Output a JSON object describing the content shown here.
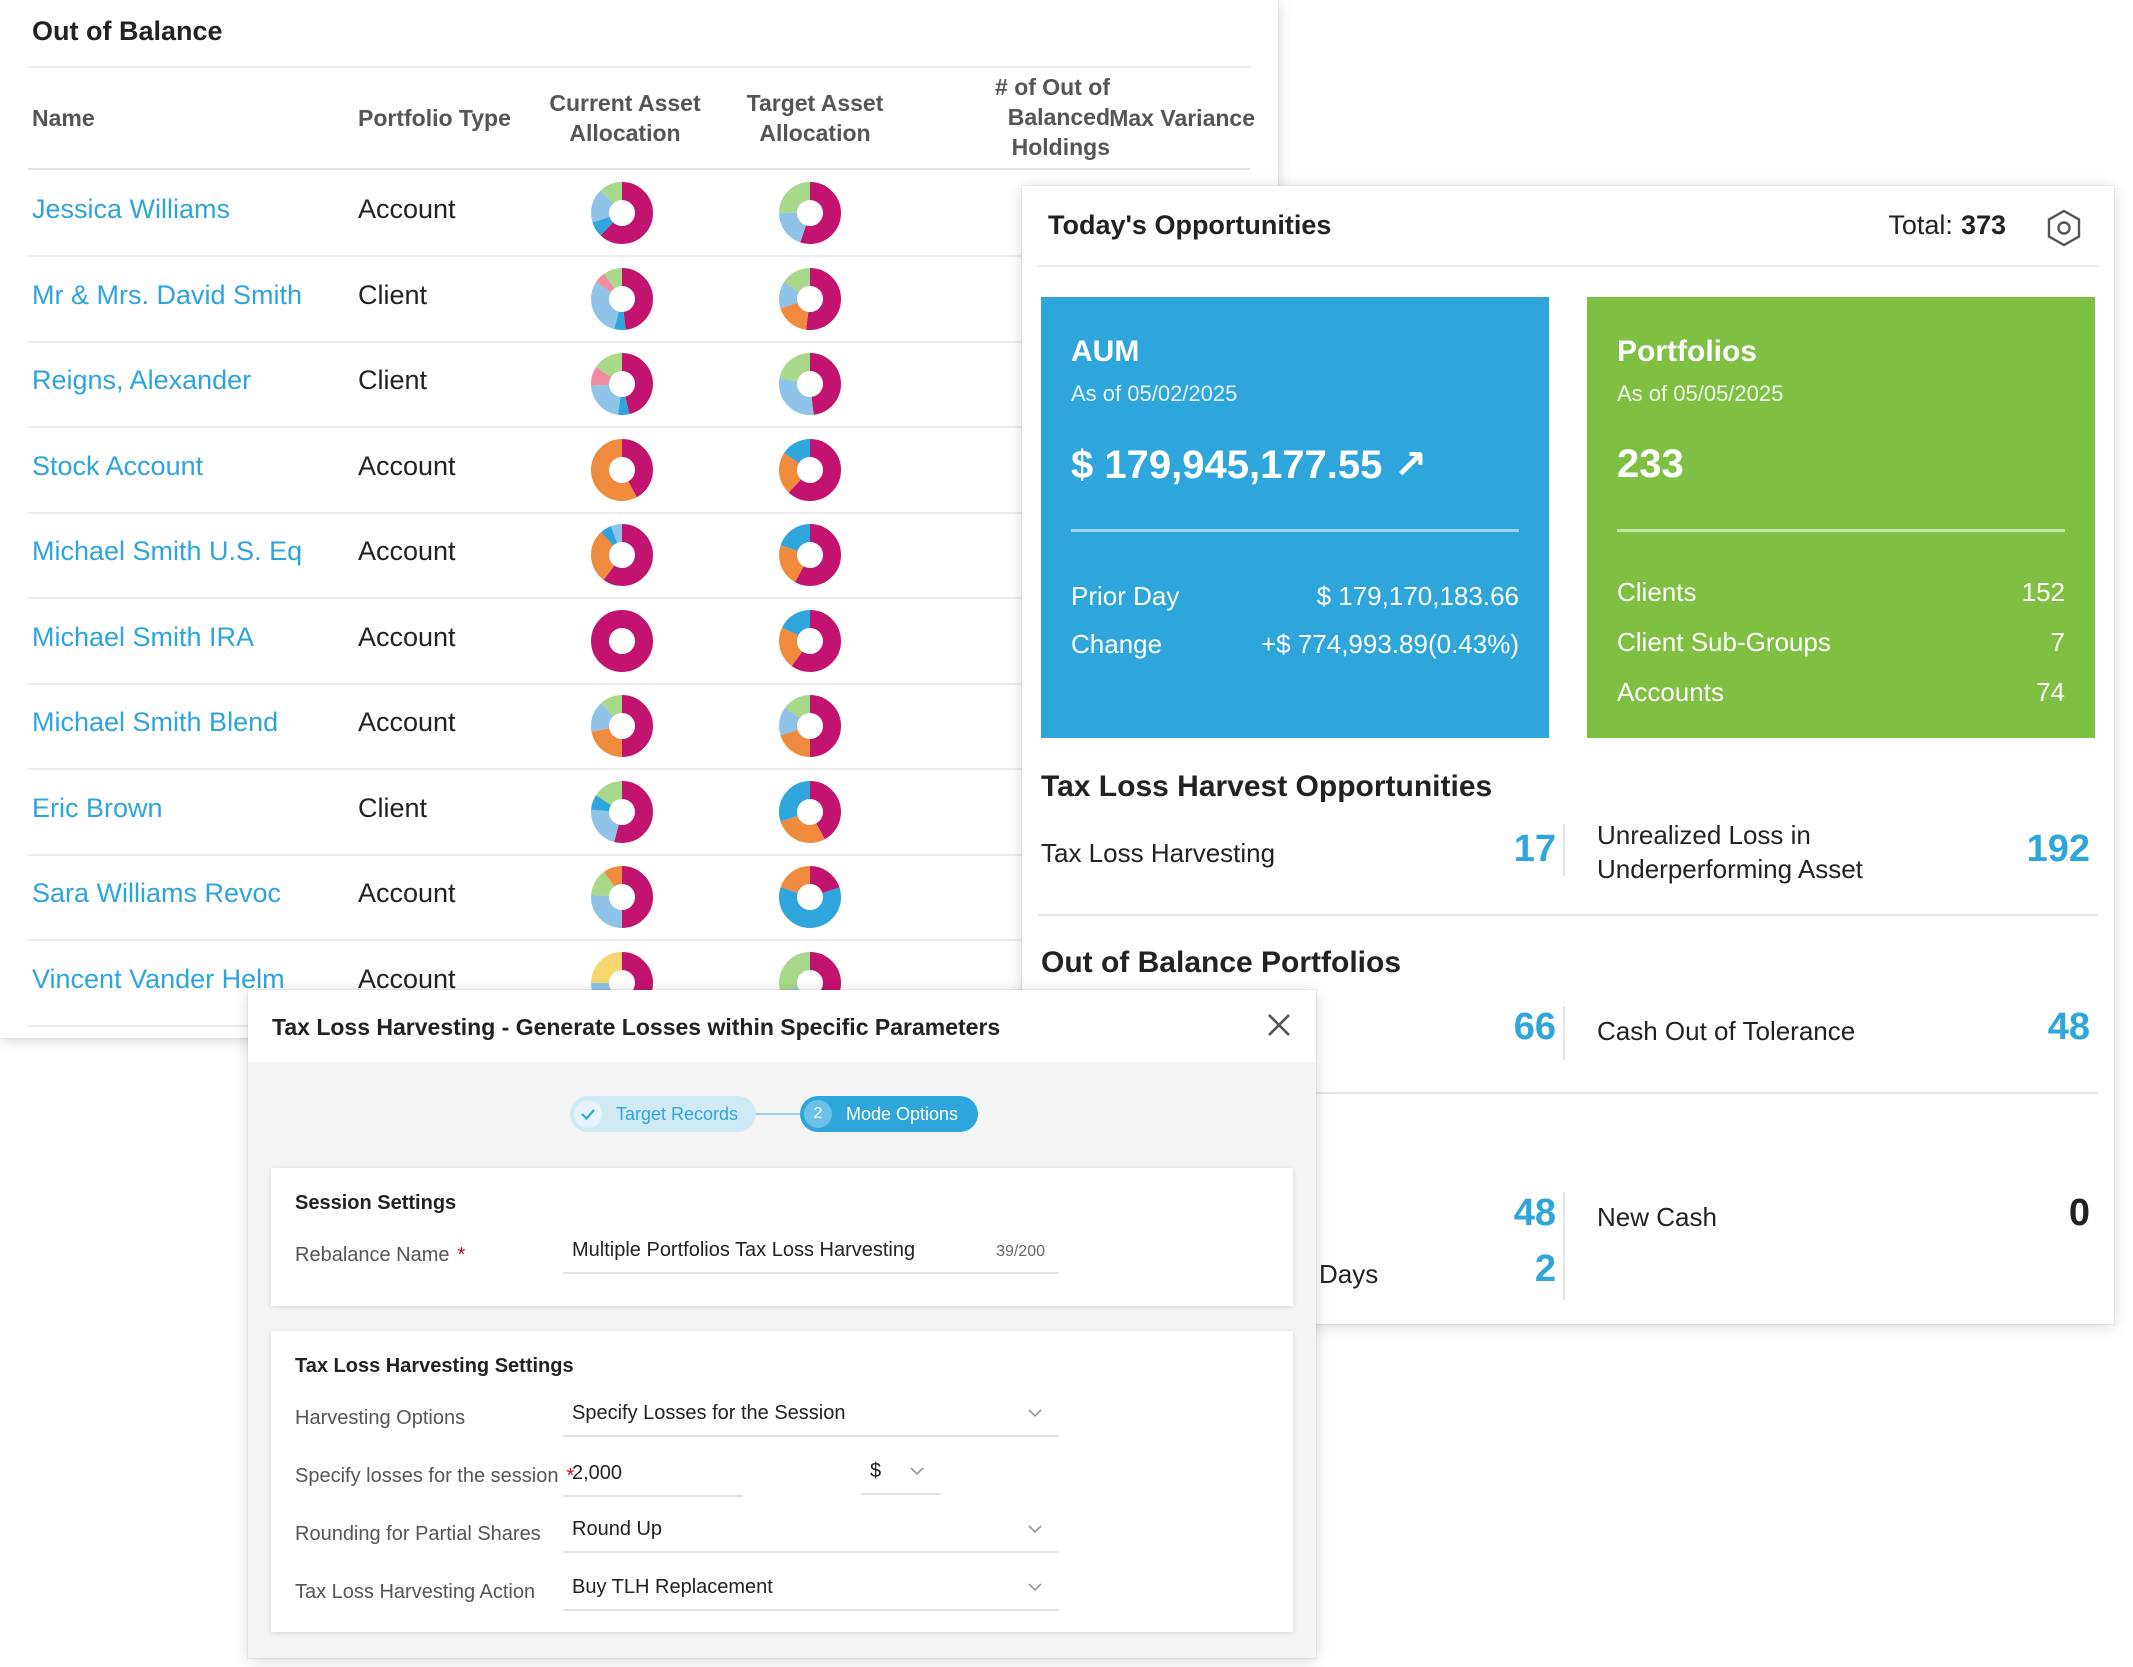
{
  "out_of_balance": {
    "title": "Out of Balance",
    "columns": {
      "name": "Name",
      "type": "Portfolio Type",
      "current_l1": "Current Asset",
      "current_l2": "Allocation",
      "target_l1": "Target Asset",
      "target_l2": "Allocation",
      "num_l1": "# of Out of",
      "num_l2": "Balanced",
      "num_l3": "Holdings",
      "max": "Max Variance"
    },
    "rows": [
      {
        "name": "Jessica Williams",
        "type": "Account"
      },
      {
        "name": "Mr & Mrs. David Smith",
        "type": "Client"
      },
      {
        "name": "Reigns, Alexander",
        "type": "Client"
      },
      {
        "name": "Stock Account",
        "type": "Account"
      },
      {
        "name": "Michael Smith U.S. Eq",
        "type": "Account"
      },
      {
        "name": "Michael Smith IRA",
        "type": "Account"
      },
      {
        "name": "Michael Smith Blend",
        "type": "Account"
      },
      {
        "name": "Eric Brown",
        "type": "Client"
      },
      {
        "name": "Sara Williams Revoc",
        "type": "Account"
      },
      {
        "name": "Vincent Vander Helm",
        "type": "Account"
      }
    ]
  },
  "opportunities": {
    "title": "Today's Opportunities",
    "total_label": "Total:",
    "total_value": "373",
    "aum": {
      "title": "AUM",
      "as_of": "As of 05/02/2025",
      "value": "$ 179,945,177.55",
      "arrow": "↗",
      "prior_label": "Prior Day",
      "prior_value": "$ 179,170,183.66",
      "change_label": "Change",
      "change_value": "+$ 774,993.89(0.43%)"
    },
    "portfolios": {
      "title": "Portfolios",
      "as_of": "As of 05/05/2025",
      "value": "233",
      "clients_label": "Clients",
      "clients_value": "152",
      "subgroups_label": "Client Sub-Groups",
      "subgroups_value": "7",
      "accounts_label": "Accounts",
      "accounts_value": "74"
    },
    "tlh_section": "Tax Loss Harvest Opportunities",
    "tlh_label": "Tax Loss Harvesting",
    "tlh_value": "17",
    "unrealized_l1": "Unrealized Loss in",
    "unrealized_l2": "Underperforming Asset",
    "unrealized_value": "192",
    "oob_section": "Out of Balance Portfolios",
    "oob_value": "66",
    "cash_tol_label": "Cash Out of Tolerance",
    "cash_tol_value": "48",
    "third_value": "48",
    "new_cash_label": "New Cash",
    "new_cash_value": "0",
    "days_label": "Days",
    "days_value": "2"
  },
  "tlh_modal": {
    "title": "Tax Loss Harvesting - Generate Losses within Specific Parameters",
    "step1_label": "Target Records",
    "step2_num": "2",
    "step2_label": "Mode Options",
    "session_header": "Session Settings",
    "rebalance_label": "Rebalance Name",
    "rebalance_value": "Multiple Portfolios Tax Loss Harvesting",
    "rebalance_count": "39/200",
    "tlh_header": "Tax Loss Harvesting Settings",
    "harvest_label": "Harvesting Options",
    "harvest_value": "Specify Losses for the Session",
    "losses_label": "Specify losses for the session",
    "losses_value": "2,000",
    "currency_value": "$",
    "rounding_label": "Rounding for Partial Shares",
    "rounding_value": "Round Up",
    "action_label": "Tax Loss Harvesting Action",
    "action_value": "Buy TLH Replacement"
  },
  "colors": {
    "magenta": "#c2136e",
    "blue": "#2ea6dc",
    "green": "#7dc042",
    "orange": "#f08a3c",
    "lightblue": "#8fc3e8",
    "lightgreen": "#a8d88a",
    "pink": "#f28aa0",
    "yellow": "#f5d76e"
  }
}
